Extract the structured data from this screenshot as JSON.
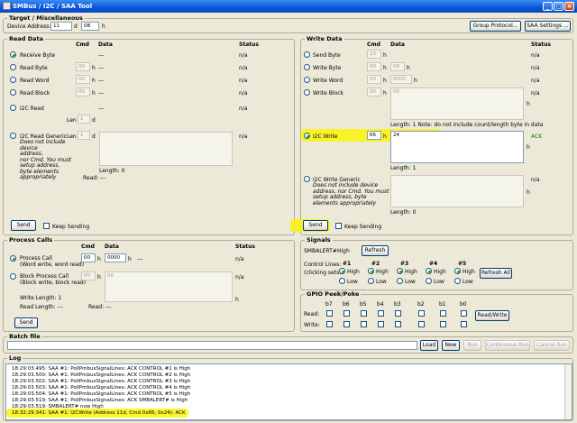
{
  "window": {
    "title": "SMBus / I2C / SAA Tool",
    "minimize": "_",
    "maximize": "□",
    "close": "×"
  },
  "target": {
    "title": "Target / Miscellaneous",
    "device_address_label": "Device Address:",
    "addr_dec": "11",
    "addr_dec_suffix": "d",
    "addr_hex": "0B",
    "addr_hex_suffix": "h",
    "group_protocol": "Group Protocol...",
    "saa_settings": "SAA Settings ..."
  },
  "read_data": {
    "title": "Read Data",
    "col_cmd": "Cmd",
    "col_data": "Data",
    "col_status": "Status",
    "rows": [
      {
        "label": "Receive Byte",
        "data": "---",
        "status": "n/a",
        "selected": true
      },
      {
        "label": "Read Byte",
        "cmd": "00",
        "cmd_suffix": "h",
        "data": "---",
        "status": "n/a"
      },
      {
        "label": "Read Word",
        "cmd": "00",
        "cmd_suffix": "h",
        "data": "---",
        "status": "n/a"
      },
      {
        "label": "Read Block",
        "cmd": "00",
        "cmd_suffix": "h",
        "data": "---",
        "status": "n/a"
      },
      {
        "label": "I2C Read",
        "data": "---",
        "status": "n/a"
      }
    ],
    "len_label": "Len",
    "len_value": "1",
    "len_suffix": "d",
    "generic_label": "I2C Read Generic",
    "generic_len_label": "Len",
    "generic_len_value": "1",
    "generic_len_suffix": "d",
    "generic_note": [
      "Does not include",
      "device",
      "address,",
      "nor Cmd. You must",
      "setup address,",
      "byte elements",
      "appropriately"
    ],
    "generic_status": "n/a",
    "length_label": "Length: 0",
    "read_label": "Read: ---",
    "send": "Send",
    "keep_sending": "Keep Sending"
  },
  "write_data": {
    "title": "Write Data",
    "col_cmd": "Cmd",
    "col_data": "Data",
    "col_status": "Status",
    "rows": [
      {
        "label": "Send Byte",
        "cmd": "23",
        "cmd_suffix": "h",
        "status": "n/a"
      },
      {
        "label": "Write Byte",
        "cmd": "00",
        "cmd_suffix": "h",
        "data": "00",
        "data_suffix": "h",
        "status": "n/a"
      },
      {
        "label": "Write Word",
        "cmd": "00",
        "cmd_suffix": "h",
        "data": "0000",
        "data_suffix": "h",
        "status": "n/a"
      },
      {
        "label": "Write Block",
        "cmd": "00",
        "cmd_suffix": "h",
        "data": "00",
        "status": "n/a"
      }
    ],
    "block_suffix": "h",
    "block_length": "Length:  1  Note: do not include count/length byte in data",
    "i2c_write_label": "I2C Write",
    "i2c_write_cmd": "66",
    "i2c_write_suffix": "h",
    "i2c_write_data": "24",
    "i2c_write_status": "ACK",
    "i2c_write_data_suffix": "h",
    "i2c_write_length": "Length: 1",
    "generic_label": "I2C Write Generic",
    "generic_note": [
      "Does not include device",
      "address, nor Cmd. You must",
      "setup address, byte",
      "elements appropriately"
    ],
    "generic_status": "n/a",
    "generic_suffix": "h",
    "generic_length": "Length: 0",
    "send": "Send",
    "keep_sending": "Keep Sending"
  },
  "process_calls": {
    "title": "Process Calls",
    "col_cmd": "Cmd",
    "col_data": "Data",
    "col_status": "Status",
    "process_call": "Process Call",
    "process_call_sub": "(Word write, word read)",
    "pc_cmd": "00",
    "pc_cmd_suffix": "h",
    "pc_data": "0000",
    "pc_data_suffix": "h",
    "pc_read": "---",
    "pc_status": "n/a",
    "block_call": "Block Process Call",
    "block_call_sub": "(Block write, block read)",
    "bc_cmd": "00",
    "bc_cmd_suffix": "h",
    "bc_data": "00",
    "bc_status": "n/a",
    "bc_suffix": "h",
    "write_length": "Write Length:  1",
    "read_length": "Read Length:  ---",
    "read_label": "Read:  ---",
    "send": "Send"
  },
  "signals": {
    "title": "Signals",
    "smbalert_label": "SMBALERT#:",
    "smbalert_value": "High",
    "refresh": "Refresh",
    "control_lines": "Control Lines:",
    "clicking_sets": "(clicking sets)",
    "lines": [
      "#1",
      "#2",
      "#3",
      "#4",
      "#5"
    ],
    "high": "High",
    "low": "Low",
    "refresh_all": "Refresh All"
  },
  "gpio": {
    "title": "GPIO Peek/Poke",
    "bits": [
      "b7",
      "b6",
      "b5",
      "b4",
      "b3",
      "b2",
      "b1",
      "b0"
    ],
    "read": "Read:",
    "write": "Write:",
    "read_write": "Read/Write"
  },
  "batch": {
    "title": "Batch file",
    "path": "",
    "load": "Load",
    "new": "New",
    "run": "Run",
    "continuous_run": "Continuous Run",
    "cancel_run": "Cancel Run"
  },
  "log": {
    "title": "Log",
    "lines": [
      "18:29:03.495: SAA #1: PollPmbusSignalLines: ACK CONTROL #1 is High",
      "18:29:03.500: SAA #1: PollPmbusSignalLines: ACK CONTROL #2 is High",
      "18:29:03.502: SAA #1: PollPmbusSignalLines: ACK CONTROL #3 is High",
      "18:29:03.503: SAA #1: PollPmbusSignalLines: ACK CONTROL #4 is High",
      "18:29:03.504: SAA #1: PollPmbusSignalLines: ACK CONTROL #5 is High",
      "18:29:03.519: SAA #1: PollPmbusSignalLines: ACK SMBALERT# is High",
      "18:29:03.519: SMBALERT# now High",
      "18:32:29.341: SAA #1: I2CWrite (Address 11d, Cmd 0x66, 0x24): ACK"
    ]
  },
  "colors": {
    "highlight": "#fbf30a",
    "ack": "#008000",
    "titlebar": "#0a55d8"
  }
}
